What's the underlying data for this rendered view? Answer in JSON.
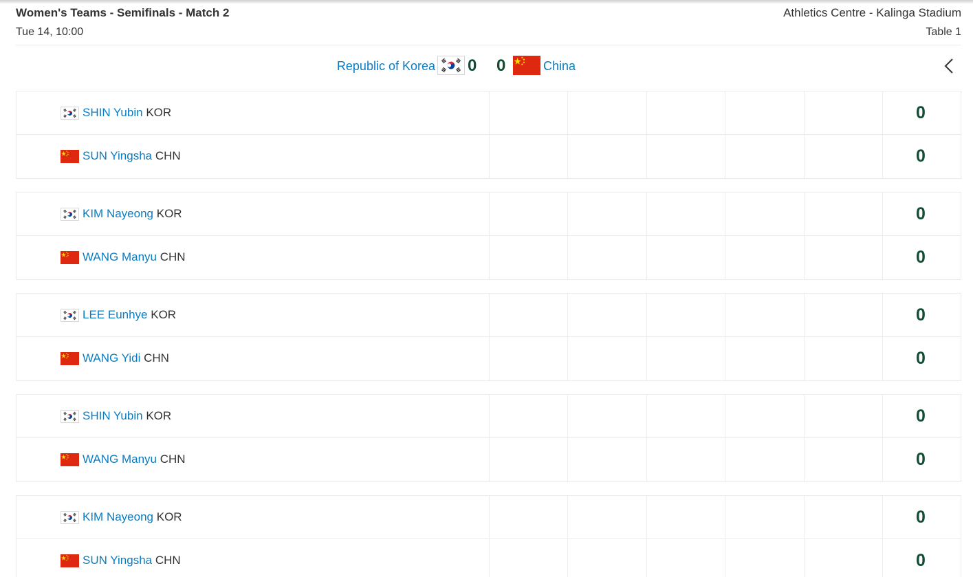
{
  "header": {
    "event_title": "Women's Teams - Semifinals - Match 2",
    "venue": "Athletics Centre - Kalinga Stadium",
    "datetime": "Tue 14, 10:00",
    "table": "Table 1"
  },
  "scoreboard": {
    "team_a": {
      "name": "Republic of Korea",
      "score": "0",
      "flag": "korea-flag-icon"
    },
    "team_b": {
      "name": "China",
      "score": "0",
      "flag": "china-flag-icon"
    },
    "back_icon": "chevron-left-icon"
  },
  "matches": [
    {
      "players": [
        {
          "name": "SHIN Yubin",
          "country": "KOR",
          "score": "0"
        },
        {
          "name": "SUN Yingsha",
          "country": "CHN",
          "score": "0"
        }
      ]
    },
    {
      "players": [
        {
          "name": "KIM Nayeong",
          "country": "KOR",
          "score": "0"
        },
        {
          "name": "WANG Manyu",
          "country": "CHN",
          "score": "0"
        }
      ]
    },
    {
      "players": [
        {
          "name": "LEE Eunhye",
          "country": "KOR",
          "score": "0"
        },
        {
          "name": "WANG Yidi",
          "country": "CHN",
          "score": "0"
        }
      ]
    },
    {
      "players": [
        {
          "name": "SHIN Yubin",
          "country": "KOR",
          "score": "0"
        },
        {
          "name": "WANG Manyu",
          "country": "CHN",
          "score": "0"
        }
      ]
    },
    {
      "players": [
        {
          "name": "KIM Nayeong",
          "country": "KOR",
          "score": "0"
        },
        {
          "name": "SUN Yingsha",
          "country": "CHN",
          "score": "0"
        }
      ]
    }
  ],
  "colors": {
    "link": "#0a7cc2",
    "score": "#114e34",
    "china_red": "#de2910",
    "china_yellow": "#ffde00",
    "korea_red": "#cd2e3a",
    "korea_blue": "#0047a0"
  }
}
